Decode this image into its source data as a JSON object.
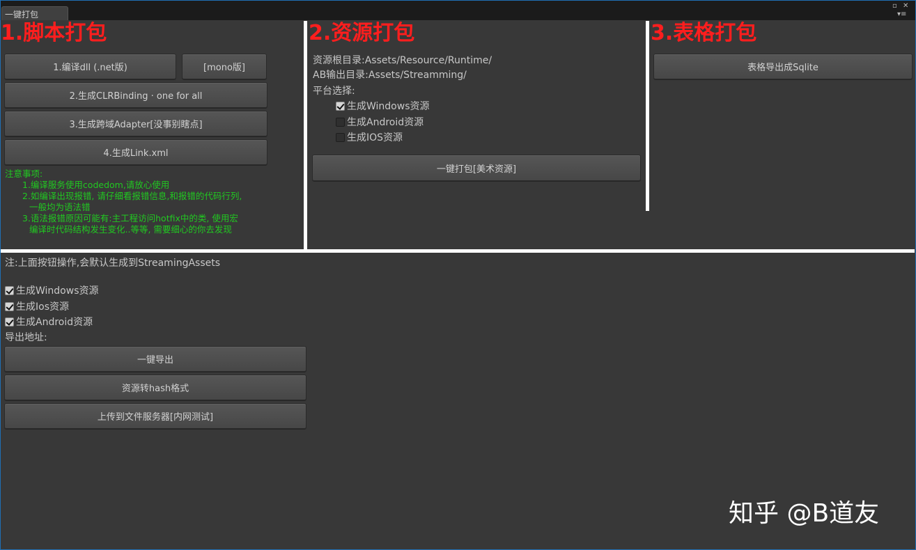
{
  "window": {
    "tab_label": "一键打包",
    "controls": [
      "maximize-icon",
      "close-icon",
      "panel-menu-icon"
    ]
  },
  "script_section": {
    "title": "1.脚本打包",
    "buttons": {
      "compile_dll": "1.编译dll (.net版)",
      "mono": "[mono版]",
      "clr_binding": "2.生成CLRBinding · one for all",
      "adapter": "3.生成跨域Adapter[没事别瞎点]",
      "link_xml": "4.生成Link.xml"
    },
    "notes": {
      "heading": "注意事项:",
      "line1": "1.编译服务使用codedom,请放心使用",
      "line2": "2.如编译出现报错, 请仔细看报错信息,和报错的代码行列,",
      "line2b": "一般均为语法错",
      "line3": "3.语法报错原因可能有:主工程访问hotfix中的类, 使用宏",
      "line3b": "编译时代码结构发生变化..等等, 需要细心的你去发现"
    }
  },
  "asset_section": {
    "title": "2.资源打包",
    "root_dir": "资源根目录:Assets/Resource/Runtime/",
    "output_dir": "AB输出目录:Assets/Streamming/",
    "platform_label": "平台选择:",
    "platforms": [
      {
        "label": "生成Windows资源",
        "checked": true
      },
      {
        "label": "生成Android资源",
        "checked": false
      },
      {
        "label": "生成IOS资源",
        "checked": false
      }
    ],
    "build_button": "一键打包[美术资源]"
  },
  "table_section": {
    "title": "3.表格打包",
    "export_button": "表格导出成Sqlite"
  },
  "bottom_section": {
    "note": "注:上面按钮操作,会默认生成到StreamingAssets",
    "options": [
      {
        "label": "生成Windows资源",
        "checked": true
      },
      {
        "label": "生成Ios资源",
        "checked": true
      },
      {
        "label": "生成Android资源",
        "checked": true
      }
    ],
    "export_path_label": "导出地址:",
    "buttons": {
      "export_all": "一键导出",
      "to_hash": "资源转hash格式",
      "upload": "上传到文件服务器[内网测试]"
    }
  },
  "watermark": "知乎 @B道友"
}
